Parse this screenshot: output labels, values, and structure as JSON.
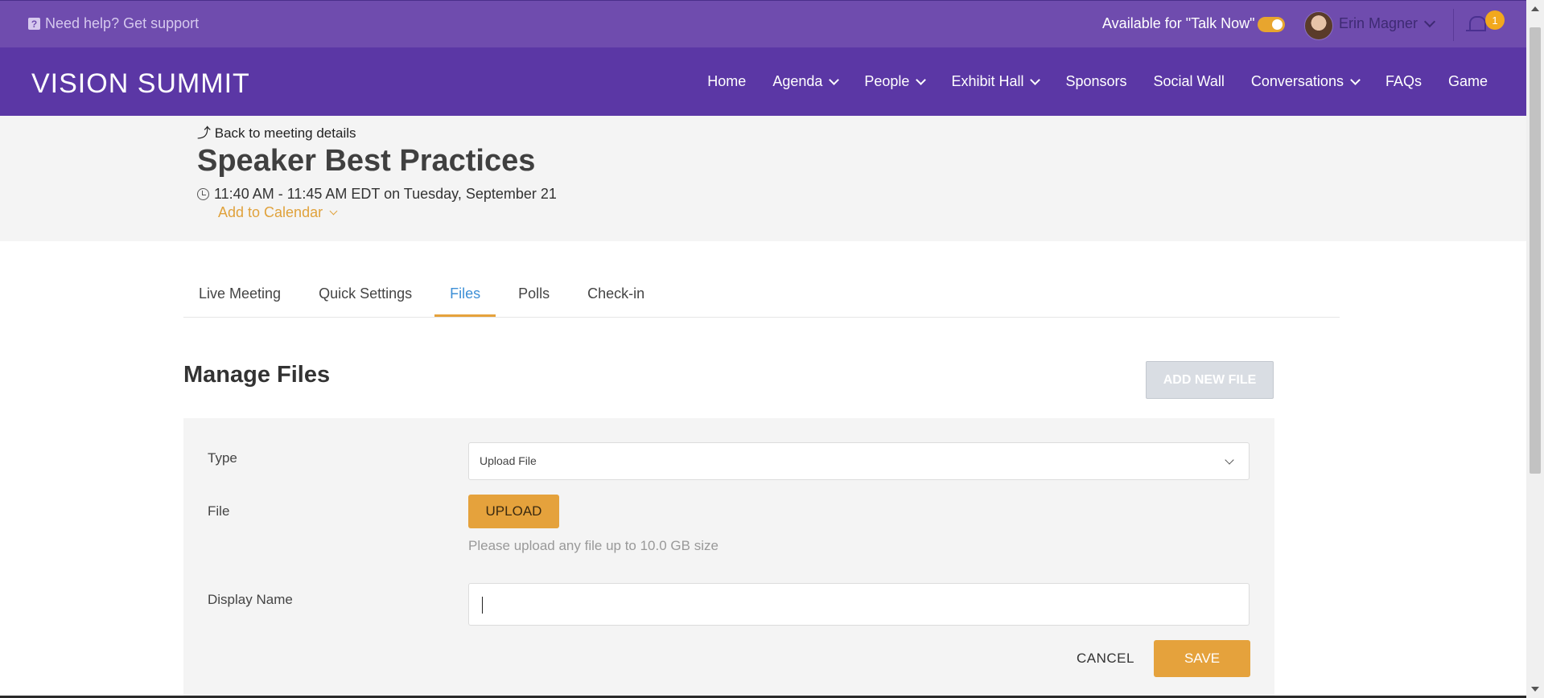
{
  "topbar": {
    "help_text": "Need help? Get support",
    "help_icon": "question-icon",
    "talk_now_label": "Available for \"Talk Now\"",
    "talk_now_enabled": true,
    "user_name": "Erin Magner",
    "notification_count": "1"
  },
  "nav": {
    "logo": "VISION SUMMIT",
    "items": [
      {
        "label": "Home",
        "dropdown": false
      },
      {
        "label": "Agenda",
        "dropdown": true
      },
      {
        "label": "People",
        "dropdown": true
      },
      {
        "label": "Exhibit Hall",
        "dropdown": true
      },
      {
        "label": "Sponsors",
        "dropdown": false
      },
      {
        "label": "Social Wall",
        "dropdown": false
      },
      {
        "label": "Conversations",
        "dropdown": true
      },
      {
        "label": "FAQs",
        "dropdown": false
      },
      {
        "label": "Game",
        "dropdown": false
      }
    ]
  },
  "meeting": {
    "back_link": "Back to meeting details",
    "title": "Speaker Best Practices",
    "time": "11:40 AM - 11:45 AM EDT on Tuesday, September 21",
    "add_to_calendar": "Add to Calendar"
  },
  "tabs": [
    "Live Meeting",
    "Quick Settings",
    "Files",
    "Polls",
    "Check-in"
  ],
  "active_tab": "Files",
  "manage_files": {
    "title": "Manage Files",
    "add_new_button": "ADD NEW FILE",
    "type_label": "Type",
    "type_value": "Upload File",
    "file_label": "File",
    "upload_button": "UPLOAD",
    "upload_hint": "Please upload any file up to 10.0 GB size",
    "display_name_label": "Display Name",
    "display_name_value": "",
    "cancel_button": "CANCEL",
    "save_button": "SAVE"
  },
  "colors": {
    "topbar": "#6f4cae",
    "nav": "#5b37a5",
    "accent": "#e5a23c",
    "active_tab": "#3d8fd6"
  }
}
